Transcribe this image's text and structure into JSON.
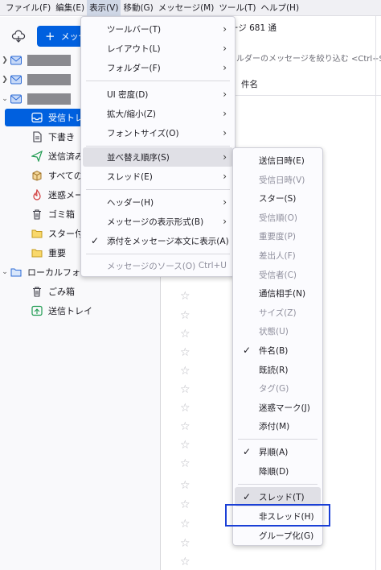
{
  "menubar": [
    "ファイル(F)",
    "編集(E)",
    "表示(V)",
    "移動(G)",
    "メッセージ(M)",
    "ツール(T)",
    "ヘルプ(H)"
  ],
  "folder_pane": {
    "new_message": "メッセ",
    "folders": [
      {
        "label": "受信トレ",
        "icon": "inbox-icon"
      },
      {
        "label": "下書き",
        "icon": "draft-icon"
      },
      {
        "label": "送信済み",
        "icon": "sent-icon"
      },
      {
        "label": "すべての",
        "icon": "archive-box-icon"
      },
      {
        "label": "迷惑メー",
        "icon": "junk-flame-icon"
      },
      {
        "label": "ゴミ箱",
        "icon": "trash-icon"
      },
      {
        "label": "スター付き",
        "icon": "folder-icon"
      },
      {
        "label": "重要",
        "icon": "folder-icon"
      },
      {
        "label": "ローカルフォル",
        "icon": "folder-icon"
      },
      {
        "label": "ごみ箱",
        "icon": "trash-icon"
      },
      {
        "label": "送信トレイ",
        "icon": "outbox-icon"
      }
    ]
  },
  "thread_pane": {
    "header": "ージ 681 通",
    "quick_filter": "ォルダーのメッセージを絞り込む <Ctrl+Shift",
    "subject_col": "件名"
  },
  "view_menu": {
    "items": [
      {
        "label": "ツールバー(T)",
        "submenu": true
      },
      {
        "label": "レイアウト(L)",
        "submenu": true
      },
      {
        "label": "フォルダー(F)",
        "submenu": true
      },
      {
        "label": "UI 密度(D)",
        "submenu": true
      },
      {
        "label": "拡大/縮小(Z)",
        "submenu": true
      },
      {
        "label": "フォントサイズ(O)",
        "submenu": true
      },
      {
        "label": "並べ替え順序(S)",
        "submenu": true
      },
      {
        "label": "スレッド(E)",
        "submenu": true
      },
      {
        "label": "ヘッダー(H)",
        "submenu": true
      },
      {
        "label": "メッセージの表示形式(B)",
        "submenu": true
      },
      {
        "label": "添付をメッセージ本文に表示(A)",
        "checked": true
      },
      {
        "label": "メッセージのソース(O)",
        "shortcut": "Ctrl+U",
        "disabled": true
      }
    ]
  },
  "sort_menu": {
    "items": [
      {
        "label": "送信日時(E)"
      },
      {
        "label": "受信日時(V)",
        "disabled": true
      },
      {
        "label": "スター(S)"
      },
      {
        "label": "受信順(O)",
        "disabled": true
      },
      {
        "label": "重要度(P)",
        "disabled": true
      },
      {
        "label": "差出人(F)",
        "disabled": true
      },
      {
        "label": "受信者(C)",
        "disabled": true
      },
      {
        "label": "通信相手(N)"
      },
      {
        "label": "サイズ(Z)",
        "disabled": true
      },
      {
        "label": "状態(U)",
        "disabled": true
      },
      {
        "label": "件名(B)",
        "checked": true
      },
      {
        "label": "既読(R)"
      },
      {
        "label": "タグ(G)",
        "disabled": true
      },
      {
        "label": "迷惑マーク(J)"
      },
      {
        "label": "添付(M)"
      },
      {
        "label": "昇順(A)",
        "checked": true
      },
      {
        "label": "降順(D)"
      },
      {
        "label": "スレッド(T)",
        "checked": true
      },
      {
        "label": "非スレッド(H)"
      },
      {
        "label": "グループ化(G)"
      }
    ]
  },
  "colors": {
    "accent": "#0060df",
    "highlight_box": "#1a3fd6"
  }
}
